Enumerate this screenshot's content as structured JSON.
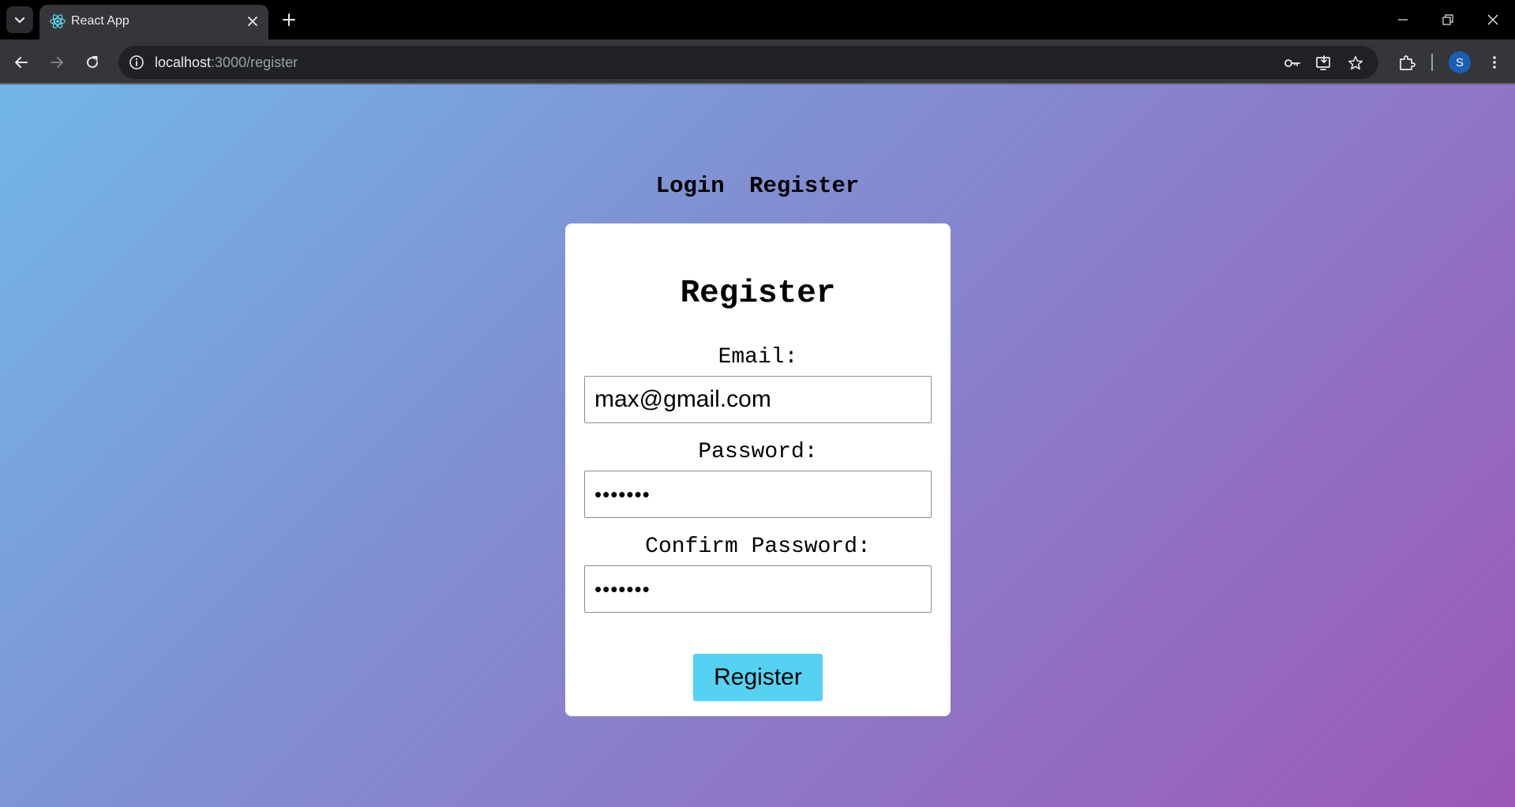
{
  "browser": {
    "tab_title": "React App",
    "url_host": "localhost",
    "url_path": ":3000/register",
    "profile_initial": "S",
    "accent": "#1a5fb4"
  },
  "nav": {
    "login_label": "Login",
    "register_label": "Register"
  },
  "form": {
    "title": "Register",
    "email_label": "Email:",
    "email_value": "max@gmail.com",
    "password_label": "Password:",
    "password_value": "1234567",
    "confirm_label": "Confirm Password:",
    "confirm_value": "1234567",
    "submit_label": "Register",
    "submit_color": "#55d2f2"
  },
  "icons": {
    "tab_search": "chevron-down-icon",
    "favicon": "react-icon",
    "close": "close-icon",
    "new_tab": "plus-icon",
    "back": "arrow-left-icon",
    "forward": "arrow-right-icon",
    "reload": "reload-icon",
    "site_info": "info-icon",
    "password_key": "key-icon",
    "install": "install-icon",
    "bookmark": "star-icon",
    "extensions": "puzzle-icon",
    "menu": "kebab-menu-icon"
  }
}
